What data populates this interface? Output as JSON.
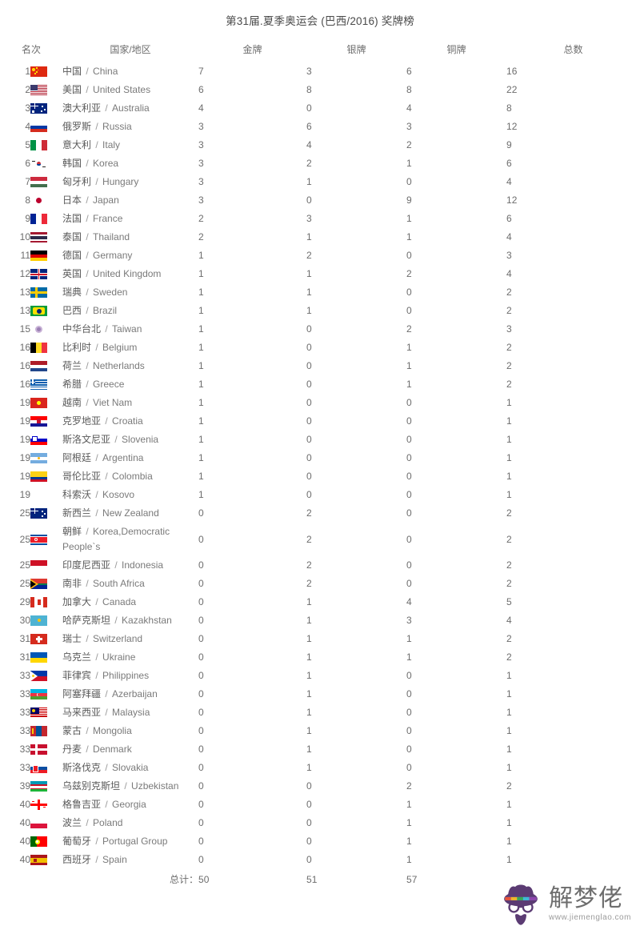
{
  "page": {
    "title": "第31届.夏季奥运会 (巴西/2016) 奖牌榜"
  },
  "table": {
    "headers": {
      "rank": "名次",
      "country": "国家/地区",
      "gold": "金牌",
      "silver": "银牌",
      "bronze": "铜牌",
      "total": "总数"
    },
    "total_label": "总计：",
    "totals": {
      "gold": "50",
      "silver": "51",
      "bronze": "57",
      "total": ""
    },
    "rows": [
      {
        "rank": "1",
        "cn": "中国",
        "en": "China",
        "gold": "7",
        "silver": "3",
        "bronze": "6",
        "total": "16",
        "flag": "cn"
      },
      {
        "rank": "2",
        "cn": "美国",
        "en": "United States",
        "gold": "6",
        "silver": "8",
        "bronze": "8",
        "total": "22",
        "flag": "us"
      },
      {
        "rank": "3",
        "cn": "澳大利亚",
        "en": "Australia",
        "gold": "4",
        "silver": "0",
        "bronze": "4",
        "total": "8",
        "flag": "au"
      },
      {
        "rank": "4",
        "cn": "俄罗斯",
        "en": "Russia",
        "gold": "3",
        "silver": "6",
        "bronze": "3",
        "total": "12",
        "flag": "ru"
      },
      {
        "rank": "5",
        "cn": "意大利",
        "en": "Italy",
        "gold": "3",
        "silver": "4",
        "bronze": "2",
        "total": "9",
        "flag": "it"
      },
      {
        "rank": "6",
        "cn": "韩国",
        "en": "Korea",
        "gold": "3",
        "silver": "2",
        "bronze": "1",
        "total": "6",
        "flag": "kr"
      },
      {
        "rank": "7",
        "cn": "匈牙利",
        "en": "Hungary",
        "gold": "3",
        "silver": "1",
        "bronze": "0",
        "total": "4",
        "flag": "hu"
      },
      {
        "rank": "8",
        "cn": "日本",
        "en": "Japan",
        "gold": "3",
        "silver": "0",
        "bronze": "9",
        "total": "12",
        "flag": "jp"
      },
      {
        "rank": "9",
        "cn": "法国",
        "en": "France",
        "gold": "2",
        "silver": "3",
        "bronze": "1",
        "total": "6",
        "flag": "fr"
      },
      {
        "rank": "10",
        "cn": "泰国",
        "en": "Thailand",
        "gold": "2",
        "silver": "1",
        "bronze": "1",
        "total": "4",
        "flag": "th"
      },
      {
        "rank": "11",
        "cn": "德国",
        "en": "Germany",
        "gold": "1",
        "silver": "2",
        "bronze": "0",
        "total": "3",
        "flag": "de"
      },
      {
        "rank": "12",
        "cn": "英国",
        "en": "United Kingdom",
        "gold": "1",
        "silver": "1",
        "bronze": "2",
        "total": "4",
        "flag": "gb"
      },
      {
        "rank": "13",
        "cn": "瑞典",
        "en": "Sweden",
        "gold": "1",
        "silver": "1",
        "bronze": "0",
        "total": "2",
        "flag": "se"
      },
      {
        "rank": "13",
        "cn": "巴西",
        "en": "Brazil",
        "gold": "1",
        "silver": "1",
        "bronze": "0",
        "total": "2",
        "flag": "br"
      },
      {
        "rank": "15",
        "cn": "中华台北",
        "en": "Taiwan",
        "gold": "1",
        "silver": "0",
        "bronze": "2",
        "total": "3",
        "flag": "tw"
      },
      {
        "rank": "16",
        "cn": "比利时",
        "en": "Belgium",
        "gold": "1",
        "silver": "0",
        "bronze": "1",
        "total": "2",
        "flag": "be"
      },
      {
        "rank": "16",
        "cn": "荷兰",
        "en": "Netherlands",
        "gold": "1",
        "silver": "0",
        "bronze": "1",
        "total": "2",
        "flag": "nl"
      },
      {
        "rank": "16",
        "cn": "希腊",
        "en": "Greece",
        "gold": "1",
        "silver": "0",
        "bronze": "1",
        "total": "2",
        "flag": "gr"
      },
      {
        "rank": "19",
        "cn": "越南",
        "en": "Viet Nam",
        "gold": "1",
        "silver": "0",
        "bronze": "0",
        "total": "1",
        "flag": "vn"
      },
      {
        "rank": "19",
        "cn": "克罗地亚",
        "en": "Croatia",
        "gold": "1",
        "silver": "0",
        "bronze": "0",
        "total": "1",
        "flag": "hr"
      },
      {
        "rank": "19",
        "cn": "斯洛文尼亚",
        "en": "Slovenia",
        "gold": "1",
        "silver": "0",
        "bronze": "0",
        "total": "1",
        "flag": "si"
      },
      {
        "rank": "19",
        "cn": "阿根廷",
        "en": "Argentina",
        "gold": "1",
        "silver": "0",
        "bronze": "0",
        "total": "1",
        "flag": "ar"
      },
      {
        "rank": "19",
        "cn": "哥伦比亚",
        "en": "Colombia",
        "gold": "1",
        "silver": "0",
        "bronze": "0",
        "total": "1",
        "flag": "co"
      },
      {
        "rank": "19",
        "cn": "科索沃",
        "en": "Kosovo",
        "gold": "1",
        "silver": "0",
        "bronze": "0",
        "total": "1",
        "flag": "none"
      },
      {
        "rank": "25",
        "cn": "新西兰",
        "en": "New Zealand",
        "gold": "0",
        "silver": "2",
        "bronze": "0",
        "total": "2",
        "flag": "nz"
      },
      {
        "rank": "25",
        "cn": "朝鲜",
        "en": "Korea,Democratic People`s",
        "gold": "0",
        "silver": "2",
        "bronze": "0",
        "total": "2",
        "flag": "kp"
      },
      {
        "rank": "25",
        "cn": "印度尼西亚",
        "en": "Indonesia",
        "gold": "0",
        "silver": "2",
        "bronze": "0",
        "total": "2",
        "flag": "id"
      },
      {
        "rank": "25",
        "cn": "南非",
        "en": "South Africa",
        "gold": "0",
        "silver": "2",
        "bronze": "0",
        "total": "2",
        "flag": "za"
      },
      {
        "rank": "29",
        "cn": "加拿大",
        "en": "Canada",
        "gold": "0",
        "silver": "1",
        "bronze": "4",
        "total": "5",
        "flag": "ca"
      },
      {
        "rank": "30",
        "cn": "哈萨克斯坦",
        "en": "Kazakhstan",
        "gold": "0",
        "silver": "1",
        "bronze": "3",
        "total": "4",
        "flag": "kz"
      },
      {
        "rank": "31",
        "cn": "瑞士",
        "en": "Switzerland",
        "gold": "0",
        "silver": "1",
        "bronze": "1",
        "total": "2",
        "flag": "ch"
      },
      {
        "rank": "31",
        "cn": "乌克兰",
        "en": "Ukraine",
        "gold": "0",
        "silver": "1",
        "bronze": "1",
        "total": "2",
        "flag": "ua"
      },
      {
        "rank": "33",
        "cn": "菲律宾",
        "en": "Philippines",
        "gold": "0",
        "silver": "1",
        "bronze": "0",
        "total": "1",
        "flag": "ph"
      },
      {
        "rank": "33",
        "cn": "阿塞拜疆",
        "en": "Azerbaijan",
        "gold": "0",
        "silver": "1",
        "bronze": "0",
        "total": "1",
        "flag": "az"
      },
      {
        "rank": "33",
        "cn": "马来西亚",
        "en": "Malaysia",
        "gold": "0",
        "silver": "1",
        "bronze": "0",
        "total": "1",
        "flag": "my"
      },
      {
        "rank": "33",
        "cn": "蒙古",
        "en": "Mongolia",
        "gold": "0",
        "silver": "1",
        "bronze": "0",
        "total": "1",
        "flag": "mn"
      },
      {
        "rank": "33",
        "cn": "丹麦",
        "en": "Denmark",
        "gold": "0",
        "silver": "1",
        "bronze": "0",
        "total": "1",
        "flag": "dk"
      },
      {
        "rank": "33",
        "cn": "斯洛伐克",
        "en": "Slovakia",
        "gold": "0",
        "silver": "1",
        "bronze": "0",
        "total": "1",
        "flag": "sk"
      },
      {
        "rank": "39",
        "cn": "乌兹别克斯坦",
        "en": "Uzbekistan",
        "gold": "0",
        "silver": "0",
        "bronze": "2",
        "total": "2",
        "flag": "uz"
      },
      {
        "rank": "40",
        "cn": "格鲁吉亚",
        "en": "Georgia",
        "gold": "0",
        "silver": "0",
        "bronze": "1",
        "total": "1",
        "flag": "ge"
      },
      {
        "rank": "40",
        "cn": "波兰",
        "en": "Poland",
        "gold": "0",
        "silver": "0",
        "bronze": "1",
        "total": "1",
        "flag": "pl"
      },
      {
        "rank": "40",
        "cn": "葡萄牙",
        "en": "Portugal Group",
        "gold": "0",
        "silver": "0",
        "bronze": "1",
        "total": "1",
        "flag": "pt"
      },
      {
        "rank": "40",
        "cn": "西班牙",
        "en": "Spain",
        "gold": "0",
        "silver": "0",
        "bronze": "1",
        "total": "1",
        "flag": "es"
      }
    ]
  },
  "watermark": {
    "brand": "解梦佬",
    "url": "www.jiemenglao.com"
  }
}
